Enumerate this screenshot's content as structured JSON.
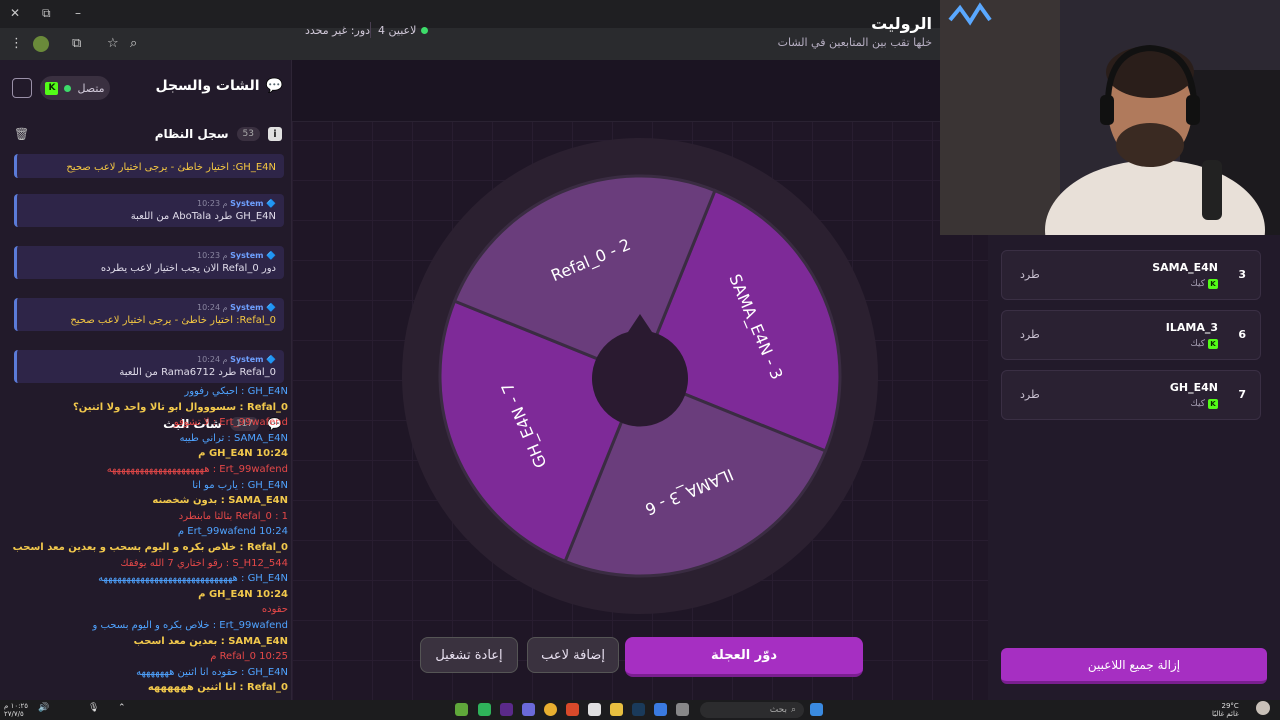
{
  "window": {
    "min": "–",
    "restore": "⧉",
    "close_label": ""
  },
  "chat_panel": {
    "title": "الشات والسجل",
    "status": "متصل",
    "system_log": {
      "title": "سجل النظام",
      "count": "53",
      "messages": [
        {
          "sender": "",
          "time": "",
          "text": "GH_E4N: اختيار خاطئ - يرجى اختيار لاعب صحيح",
          "warn": true
        },
        {
          "sender": "System",
          "time": "10:23 م",
          "text": "GH_E4N طرد AboTala من اللعبة",
          "warn": false
        },
        {
          "sender": "System",
          "time": "10:23 م",
          "text": "دور Refal_0 الان يجب اختيار لاعب يطرده",
          "warn": false
        },
        {
          "sender": "System",
          "time": "10:24 م",
          "text": "Refal_0: اختيار خاطئ - يرجى اختيار لاعب صحيح",
          "warn": true
        },
        {
          "sender": "System",
          "time": "10:24 م",
          "text": "Refal_0 طرد Rama6712 من اللعبة",
          "warn": false
        }
      ]
    },
    "stream_chat": {
      "title": "شات البث",
      "count": "117",
      "lines": [
        "GH_E4N : احبكي رفوور",
        "Refal_0 : سسوووال ابو تالا واحد ولا اثنين؟",
        "Ert_99wafend : لا تشوفو",
        "SAMA_E4N : تراني طيبه",
        "GH_E4N 10:24 م",
        "Ert_99wafend : هههههههههههههههههههههه",
        "GH_E4N : يارب مو انا",
        "SAMA_E4N : بدون شخصنه",
        "Refal_0 : 1 بثالثا مابنطرد",
        "Ert_99wafend 10:24 م",
        "Refal_0 : خلاص بكره و اليوم بسحب و بعدين معد اسحب",
        "S_H12_544 : رقو اختاري 7 الله يوفقك",
        "GH_E4N : هههههههههههههههههههههههههههههه",
        "GH_E4N 10:24 م",
        "حقوده",
        "Ert_99wafend : خلاص بكره و اليوم بسحب و",
        "SAMA_E4N : بعدين معد اسحب",
        "Refal_0 10:25 م",
        "GH_E4N : حقوده انا اثنين هههههههه",
        "Refal_0 : انا اثنين ههههههه"
      ]
    }
  },
  "header": {
    "title": "الروليت",
    "subtitle": "خلها تقب بين المتابعين في الشات",
    "players_count": "4 لاعبين",
    "turn": "دور: غير محدد"
  },
  "wheel": {
    "segments": [
      {
        "label": "SAMA_E4N - 3",
        "color": "#7e2a98"
      },
      {
        "label": "ILAMA_3 - 6",
        "color": "#6a3d7c"
      },
      {
        "label": "GH_E4N - 7",
        "color": "#7e2a98"
      },
      {
        "label": "Refal_0 - 2",
        "color": "#6a3d7c"
      }
    ]
  },
  "buttons": {
    "spin": "دوّر العجلة",
    "add_player": "إضافة لاعب",
    "restart": "إعادة تشغيل",
    "remove_all": "إزالة جميع اللاعبين"
  },
  "players": [
    {
      "num": "",
      "name": "",
      "platform": "كيك",
      "kick": ""
    },
    {
      "num": "3",
      "name": "SAMA_E4N",
      "platform": "كيك",
      "kick": "طرد"
    },
    {
      "num": "6",
      "name": "ILAMA_3",
      "platform": "كيك",
      "kick": "طرد"
    },
    {
      "num": "7",
      "name": "GH_E4N",
      "platform": "كيك",
      "kick": "طرد"
    }
  ],
  "taskbar": {
    "search": "بحث",
    "time": "١٠:٢٥ م",
    "date": "٢٧/٧/٥",
    "weather_temp": "29°C",
    "weather_text": "غائم غالبًا"
  }
}
